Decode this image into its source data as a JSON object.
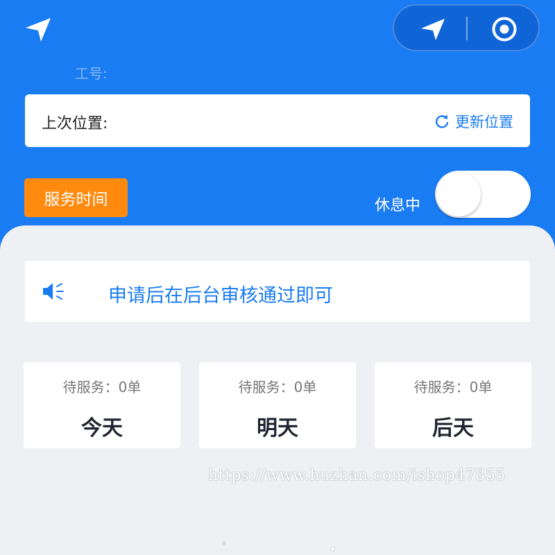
{
  "header": {
    "employee_label": "工号:",
    "last_location_label": "上次位置:",
    "update_location_label": "更新位置",
    "service_time_label": "服务时间",
    "status_label": "休息中",
    "status_toggle_on": false
  },
  "notice": {
    "text": "申请后在后台审核通过即可"
  },
  "days": [
    {
      "pending": "待服务：0单",
      "name": "今天"
    },
    {
      "pending": "待服务：0单",
      "name": "明天"
    },
    {
      "pending": "待服务：0单",
      "name": "后天"
    }
  ],
  "watermark": "https://www.huzhan.com/ishop47855",
  "colors": {
    "primary": "#1a7cf2",
    "accent_orange": "#ff8a0e",
    "content_bg": "#eef0f4"
  },
  "icons": {
    "top_left": "navigation-arrow-icon",
    "capsule_left": "navigation-arrow-icon",
    "capsule_right": "target-icon",
    "update": "refresh-icon",
    "notice": "speaker-icon"
  }
}
